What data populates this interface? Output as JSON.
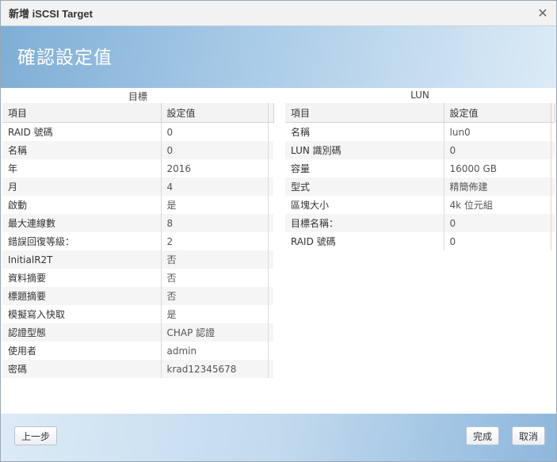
{
  "window": {
    "title": "新增 iSCSI Target",
    "close_icon": "close-icon"
  },
  "banner": {
    "heading": "確認設定值"
  },
  "target": {
    "section_label": "目標",
    "columns": [
      "項目",
      "設定值"
    ],
    "rows": [
      [
        "RAID 號碼",
        "0"
      ],
      [
        "名稱",
        "0"
      ],
      [
        "年",
        "2016"
      ],
      [
        "月",
        "4"
      ],
      [
        "啟動",
        "是"
      ],
      [
        "最大連線數",
        "8"
      ],
      [
        "錯誤回復等級：",
        "2"
      ],
      [
        "InitialR2T",
        "否"
      ],
      [
        "資料摘要",
        "否"
      ],
      [
        "標題摘要",
        "否"
      ],
      [
        "模擬寫入快取",
        "是"
      ],
      [
        "認證型態",
        "CHAP 認證"
      ],
      [
        "使用者",
        "admin"
      ],
      [
        "密碼",
        "krad12345678"
      ]
    ]
  },
  "lun": {
    "section_label": "LUN",
    "columns": [
      "項目",
      "設定值"
    ],
    "rows": [
      [
        "名稱",
        "lun0"
      ],
      [
        "LUN 識別碼",
        "0"
      ],
      [
        "容量",
        "16000 GB"
      ],
      [
        "型式",
        "精簡佈建"
      ],
      [
        "區塊大小",
        "4k 位元組"
      ],
      [
        "目標名稱：",
        "0"
      ],
      [
        "RAID 號碼",
        "0"
      ]
    ]
  },
  "footer": {
    "back_label": "上一步",
    "finish_label": "完成",
    "cancel_label": "取消"
  }
}
